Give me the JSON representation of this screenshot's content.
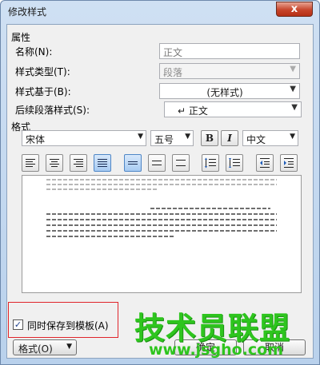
{
  "window": {
    "title": "修改样式",
    "close_glyph": "x"
  },
  "properties": {
    "section_label": "属性",
    "name_label": "名称(N):",
    "name_value": "正文",
    "style_type_label": "样式类型(T):",
    "style_type_value": "段落",
    "based_on_label": "样式基于(B):",
    "based_on_value": "(无样式)",
    "following_label": "后续段落样式(S):",
    "following_value": "↵ 正文"
  },
  "format": {
    "section_label": "格式",
    "font_value": "宋体",
    "size_value": "五号",
    "bold_label": "B",
    "italic_label": "I",
    "lang_value": "中文"
  },
  "alignment_buttons": [
    "align-left",
    "align-center",
    "align-right",
    "justify",
    "distributed",
    "line-spacing-single",
    "line-spacing-1.5",
    "line-spacing-double",
    "spacing-increase",
    "spacing-decrease",
    "indent-decrease",
    "indent-increase"
  ],
  "footer": {
    "save_to_template_label": "同时保存到模板(A)",
    "save_to_template_checked": true,
    "format_button_label": "格式(O)",
    "ok_label": "确定",
    "cancel_label": "取消"
  },
  "watermark": {
    "title": "技术员联盟",
    "url": "www.jsgho.com"
  },
  "colors": {
    "accent": "#4f86c6",
    "highlight": "#e0242a",
    "watermark": "#2ec51e"
  }
}
